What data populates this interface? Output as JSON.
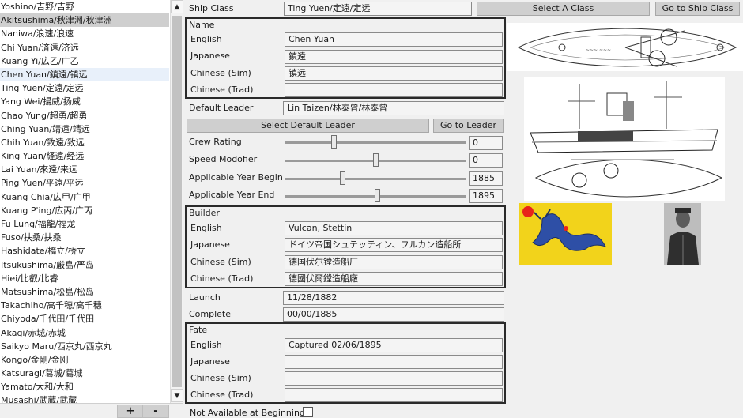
{
  "ship_list": {
    "items": [
      "Yoshino/吉野/吉野",
      "Akitsushima/秋津洲/秋津洲",
      "Naniwa/浪速/浪速",
      "Chi Yuan/済遠/济远",
      "Kuang Yi/広乙/广乙",
      "Chen Yuan/鎮遠/镇远",
      "Ting Yuen/定遠/定远",
      "Yang Wei/揚威/扬威",
      "Chao Yung/超勇/超勇",
      "Ching Yuan/靖遠/靖远",
      "Chih Yuan/致遠/致远",
      "King Yuan/経遠/经远",
      "Lai Yuan/來遠/来远",
      "Ping Yuen/平遠/平远",
      "Kuang Chia/広甲/广甲",
      "Kuang P'ing/広丙/广丙",
      "Fu Lung/福龍/福龙",
      "Fuso/扶桑/扶桑",
      "Hashidate/橋立/桥立",
      "Itsukushima/厳島/严岛",
      "Hiei/比叡/比睿",
      "Matsushima/松島/松岛",
      "Takachiho/高千穂/高千穗",
      "Chiyoda/千代田/千代田",
      "Akagi/赤城/赤城",
      "Saikyo Maru/西京丸/西京丸",
      "Kongo/金剛/金刚",
      "Katsuragi/葛城/葛城",
      "Yamato/大和/大和",
      "Musashi/武蔵/武藏"
    ],
    "selected_index": 1,
    "hover_index": 5,
    "scroll_up": "▲",
    "scroll_down": "▼",
    "add_label": "+",
    "remove_label": "-"
  },
  "form": {
    "ship_class_label": "Ship Class",
    "ship_class_value": "Ting Yuen/定遠/定远",
    "select_class_button": "Select A Class",
    "goto_class_button": "Go to Ship Class",
    "name": {
      "title": "Name",
      "english_label": "English",
      "english_value": "Chen Yuan",
      "japanese_label": "Japanese",
      "japanese_value": "鎮遠",
      "chinese_sim_label": "Chinese (Sim)",
      "chinese_sim_value": "镇远",
      "chinese_trad_label": "Chinese (Trad)",
      "chinese_trad_value": ""
    },
    "default_leader_label": "Default Leader",
    "default_leader_value": "Lin Taizen/林泰曾/林泰曾",
    "select_leader_button": "Select Default Leader",
    "goto_leader_button": "Go to Leader",
    "crew_rating": {
      "label": "Crew Rating",
      "value": "0",
      "fraction": 0.27
    },
    "speed_modifier": {
      "label": "Speed Modofier",
      "value": "0",
      "fraction": 0.5
    },
    "year_begin": {
      "label": "Applicable Year Begin",
      "value": "1885",
      "fraction": 0.32
    },
    "year_end": {
      "label": "Applicable Year End",
      "value": "1895",
      "fraction": 0.51
    },
    "builder": {
      "title": "Builder",
      "english_label": "English",
      "english_value": "Vulcan, Stettin",
      "japanese_label": "Japanese",
      "japanese_value": "ドイツ帝国シュテッティン、フルカン造船所",
      "chinese_sim_label": "Chinese (Sim)",
      "chinese_sim_value": "德国伏尔镗造船厂",
      "chinese_trad_label": "Chinese (Trad)",
      "chinese_trad_value": "德國伏爾鏜造船廠"
    },
    "launch_label": "Launch",
    "launch_value": "11/28/1882",
    "complete_label": "Complete",
    "complete_value": "00/00/1885",
    "fate": {
      "title": "Fate",
      "english_label": "English",
      "english_value": "Captured 02/06/1895",
      "japanese_label": "Japanese",
      "japanese_value": "",
      "chinese_sim_label": "Chinese (Sim)",
      "chinese_sim_value": "",
      "chinese_trad_label": "Chinese (Trad)",
      "chinese_trad_value": ""
    },
    "not_available_label": "Not Available at Beginning",
    "not_available_checked": false
  },
  "images": {
    "plan_icon": "ship-plan-drawing",
    "profile_icon": "ship-profile-drawing",
    "flag_icon": "qing-dragon-flag",
    "portrait_icon": "leader-portrait",
    "colors": {
      "flag_yellow": "#f2d31b",
      "flag_sun": "#e8241a",
      "dragon_blue": "#2e4fa6"
    }
  }
}
